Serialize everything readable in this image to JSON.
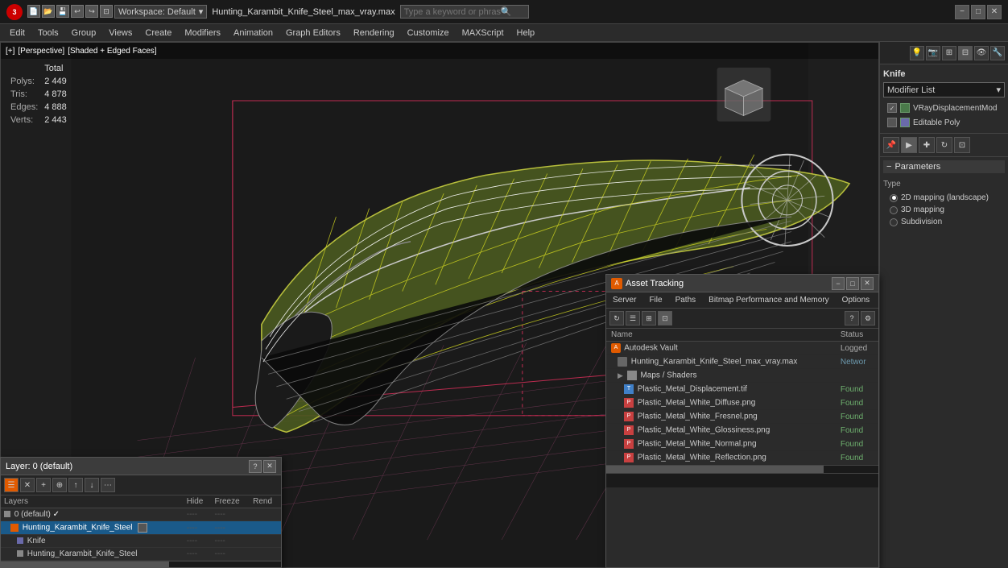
{
  "titlebar": {
    "logo": "3",
    "filename": "Hunting_Karambit_Knife_Steel_max_vray.max",
    "workspace": "Workspace: Default",
    "search_placeholder": "Type a keyword or phrase",
    "min_label": "−",
    "max_label": "□",
    "close_label": "✕"
  },
  "menubar": {
    "items": [
      "Edit",
      "Tools",
      "Group",
      "Views",
      "Create",
      "Modifiers",
      "Animation",
      "Graph Editors",
      "Rendering",
      "Customize",
      "MAXScript",
      "Help"
    ]
  },
  "viewport": {
    "header": "[+] [Perspective] [Shaded + Edged Faces]",
    "header_parts": [
      "[+]",
      "[Perspective]",
      "[Shaded + Edged Faces]"
    ],
    "stats": {
      "label_total": "Total",
      "polys_label": "Polys:",
      "polys_val": "2 449",
      "tris_label": "Tris:",
      "tris_val": "4 878",
      "edges_label": "Edges:",
      "edges_val": "4 888",
      "verts_label": "Verts:",
      "verts_val": "2 443"
    }
  },
  "right_panel": {
    "title": "Knife",
    "modifier_list_label": "Modifier List",
    "modifiers": [
      {
        "name": "VRayDisplacementMod",
        "enabled": true
      },
      {
        "name": "Editable Poly",
        "enabled": true
      }
    ],
    "parameters_title": "Parameters",
    "type_label": "Type",
    "type_options": [
      {
        "label": "2D mapping (landscape)",
        "selected": true
      },
      {
        "label": "3D mapping",
        "selected": false
      },
      {
        "label": "Subdivision",
        "selected": false
      }
    ]
  },
  "layer_panel": {
    "title": "Layer: 0 (default)",
    "close_label": "✕",
    "help_label": "?",
    "columns": [
      "Layers",
      "Hide",
      "Freeze",
      "Rend"
    ],
    "rows": [
      {
        "indent": 0,
        "icon": "layer",
        "name": "0 (default)",
        "check": true,
        "hide": "----",
        "freeze": "----",
        "rend": ""
      },
      {
        "indent": 1,
        "icon": "orange",
        "name": "Hunting_Karambit_Knife_Steel",
        "check": false,
        "hide": "----",
        "freeze": "----",
        "rend": "",
        "selected": true
      },
      {
        "indent": 2,
        "icon": "knife",
        "name": "Knife",
        "check": false,
        "hide": "----",
        "freeze": "----",
        "rend": ""
      },
      {
        "indent": 2,
        "icon": "mesh",
        "name": "Hunting_Karambit_Knife_Steel",
        "check": false,
        "hide": "----",
        "freeze": "----",
        "rend": ""
      }
    ]
  },
  "asset_panel": {
    "title": "Asset Tracking",
    "icon": "A",
    "min_label": "−",
    "max_label": "□",
    "close_label": "✕",
    "menu_items": [
      "Server",
      "File",
      "Paths",
      "Bitmap Performance and Memory",
      "Options"
    ],
    "columns": [
      "Name",
      "Status"
    ],
    "rows": [
      {
        "indent": 0,
        "icon": "autodesk",
        "name": "Autodesk Vault",
        "status": "Logged",
        "status_type": "logged"
      },
      {
        "indent": 1,
        "icon": "hunting",
        "name": "Hunting_Karambit_Knife_Steel_max_vray.max",
        "status": "Networ",
        "status_type": "network"
      },
      {
        "indent": 1,
        "icon": "maps",
        "name": "Maps / Shaders",
        "status": "",
        "status_type": ""
      },
      {
        "indent": 2,
        "icon": "tif",
        "name": "Plastic_Metal_Displacement.tif",
        "status": "Found",
        "status_type": "found"
      },
      {
        "indent": 2,
        "icon": "png",
        "name": "Plastic_Metal_White_Diffuse.png",
        "status": "Found",
        "status_type": "found"
      },
      {
        "indent": 2,
        "icon": "png",
        "name": "Plastic_Metal_White_Fresnel.png",
        "status": "Found",
        "status_type": "found"
      },
      {
        "indent": 2,
        "icon": "png",
        "name": "Plastic_Metal_White_Glossiness.png",
        "status": "Found",
        "status_type": "found"
      },
      {
        "indent": 2,
        "icon": "png",
        "name": "Plastic_Metal_White_Normal.png",
        "status": "Found",
        "status_type": "found"
      },
      {
        "indent": 2,
        "icon": "png",
        "name": "Plastic_Metal_White_Reflection.png",
        "status": "Found",
        "status_type": "found"
      }
    ]
  }
}
